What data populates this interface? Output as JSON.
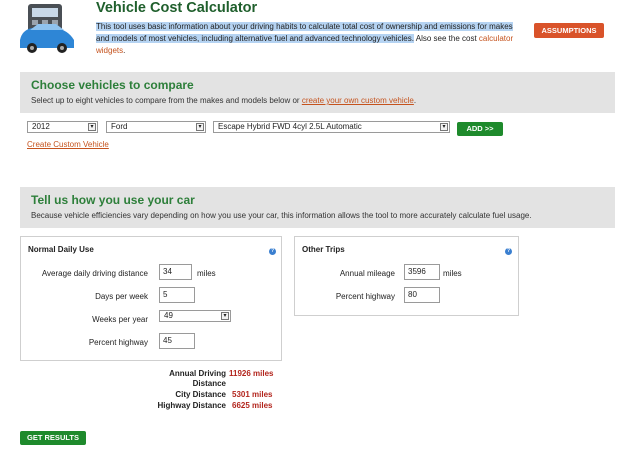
{
  "header": {
    "title": "Vehicle Cost Calculator",
    "intro_highlighted": "This tool uses basic information about your driving habits to calculate total cost of ownership and emissions for makes and models of most vehicles, including alternative fuel and advanced technology vehicles.",
    "intro_rest": " Also see the cost ",
    "widgets_link": "calculator widgets",
    "intro_end": ".",
    "assumptions_label": "ASSUMPTIONS"
  },
  "choose": {
    "title": "Choose vehicles to compare",
    "subtitle": "Select up to eight vehicles to compare from the makes and models below or ",
    "custom_link": "create your own custom vehicle",
    "subtitle_end": ".",
    "year": "2012",
    "make": "Ford",
    "model": "Escape Hybrid FWD 4cyl 2.5L Automatic",
    "add_label": "ADD >>",
    "create_custom_label": "Create Custom Vehicle"
  },
  "usage": {
    "title": "Tell us how you use your car",
    "subtitle": "Because vehicle efficiencies vary depending on how you use your car, this information allows the tool to more accurately calculate fuel usage."
  },
  "normal_daily": {
    "title": "Normal Daily Use",
    "avg_distance_label": "Average daily driving distance",
    "avg_distance_value": "34",
    "avg_distance_unit": "miles",
    "days_label": "Days per week",
    "days_value": "5",
    "weeks_label": "Weeks per year",
    "weeks_value": "49",
    "highway_label": "Percent highway",
    "highway_value": "45"
  },
  "other_trips": {
    "title": "Other Trips",
    "mileage_label": "Annual mileage",
    "mileage_value": "3596",
    "mileage_unit": "miles",
    "highway_label": "Percent highway",
    "highway_value": "80"
  },
  "summary": {
    "annual_label_1": "Annual Driving",
    "annual_label_2": "Distance",
    "annual_value": "11926 miles",
    "city_label": "City Distance",
    "city_value": "5301 miles",
    "highway_label": "Highway Distance",
    "highway_value": "6625 miles"
  },
  "get_results_label": "GET RESULTS",
  "colors": {
    "title_green": "#1f5f2c",
    "section_green": "#2d7f3a",
    "button_green": "#1e8a2c",
    "assumptions_orange": "#d9532a",
    "link_orange": "#c5531e",
    "value_red": "#b3261e"
  },
  "icons": {
    "logo": "car-calculator-icon",
    "help": "help-icon",
    "dropdown": "chevron-down-icon"
  }
}
